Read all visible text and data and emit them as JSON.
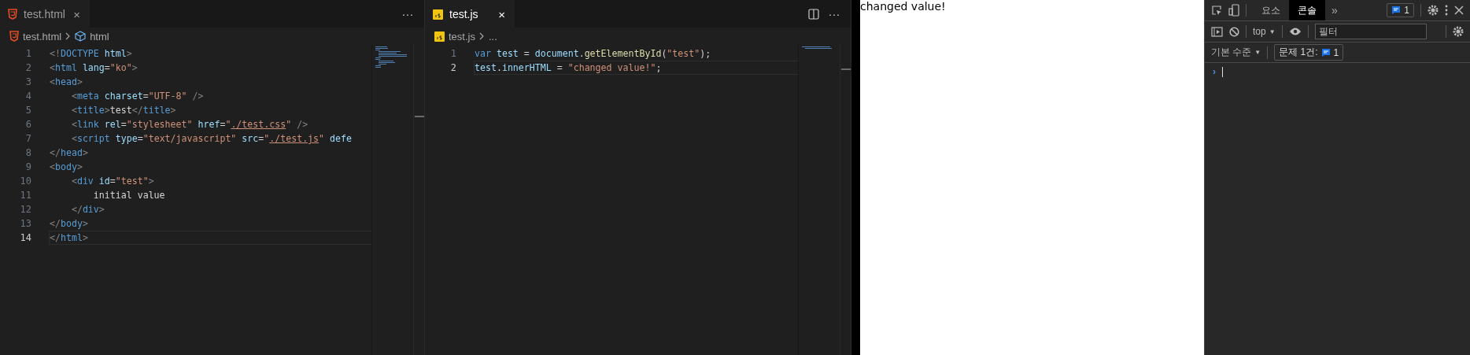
{
  "editors": [
    {
      "focused": false,
      "tabs": [
        {
          "label": "test.html",
          "close": "×",
          "selected": true
        }
      ],
      "more": "···",
      "breadcrumb": [
        {
          "label": "test.html"
        },
        {
          "label": "html"
        }
      ],
      "lines": [
        {
          "number": "1",
          "current": false,
          "tokens": [
            {
              "t": "<!",
              "kind": "punct"
            },
            {
              "t": "DOCTYPE",
              "kind": "tag"
            },
            {
              "t": " html",
              "kind": "attr"
            },
            {
              "t": ">",
              "kind": "punct"
            }
          ]
        },
        {
          "number": "2",
          "current": false,
          "tokens": [
            {
              "t": "<",
              "kind": "punct"
            },
            {
              "t": "html",
              "kind": "tag"
            },
            {
              "t": " lang",
              "kind": "attr"
            },
            {
              "t": "=",
              "kind": "text"
            },
            {
              "t": "\"ko\"",
              "kind": "str"
            },
            {
              "t": ">",
              "kind": "punct"
            }
          ]
        },
        {
          "number": "3",
          "current": false,
          "tokens": [
            {
              "t": "<",
              "kind": "punct"
            },
            {
              "t": "head",
              "kind": "tag"
            },
            {
              "t": ">",
              "kind": "punct"
            }
          ]
        },
        {
          "number": "4",
          "current": false,
          "tokens": [
            {
              "t": "    <",
              "kind": "punct"
            },
            {
              "t": "meta",
              "kind": "tag"
            },
            {
              "t": " charset",
              "kind": "attr"
            },
            {
              "t": "=",
              "kind": "text"
            },
            {
              "t": "\"UTF-8\"",
              "kind": "str"
            },
            {
              "t": " />",
              "kind": "punct"
            }
          ]
        },
        {
          "number": "5",
          "current": false,
          "tokens": [
            {
              "t": "    <",
              "kind": "punct"
            },
            {
              "t": "title",
              "kind": "tag"
            },
            {
              "t": ">",
              "kind": "punct"
            },
            {
              "t": "test",
              "kind": "text"
            },
            {
              "t": "</",
              "kind": "punct"
            },
            {
              "t": "title",
              "kind": "tag"
            },
            {
              "t": ">",
              "kind": "punct"
            }
          ]
        },
        {
          "number": "6",
          "current": false,
          "tokens": [
            {
              "t": "    <",
              "kind": "punct"
            },
            {
              "t": "link",
              "kind": "tag"
            },
            {
              "t": " rel",
              "kind": "attr"
            },
            {
              "t": "=",
              "kind": "text"
            },
            {
              "t": "\"stylesheet\"",
              "kind": "str"
            },
            {
              "t": " href",
              "kind": "attr"
            },
            {
              "t": "=",
              "kind": "text"
            },
            {
              "t": "\"",
              "kind": "str"
            },
            {
              "t": "./test.css",
              "kind": "link"
            },
            {
              "t": "\"",
              "kind": "str"
            },
            {
              "t": " />",
              "kind": "punct"
            }
          ]
        },
        {
          "number": "7",
          "current": false,
          "tokens": [
            {
              "t": "    <",
              "kind": "punct"
            },
            {
              "t": "script",
              "kind": "tag"
            },
            {
              "t": " type",
              "kind": "attr"
            },
            {
              "t": "=",
              "kind": "text"
            },
            {
              "t": "\"text/javascript\"",
              "kind": "str"
            },
            {
              "t": " src",
              "kind": "attr"
            },
            {
              "t": "=",
              "kind": "text"
            },
            {
              "t": "\"",
              "kind": "str"
            },
            {
              "t": "./test.js",
              "kind": "link"
            },
            {
              "t": "\"",
              "kind": "str"
            },
            {
              "t": " defe",
              "kind": "attr"
            }
          ]
        },
        {
          "number": "8",
          "current": false,
          "tokens": [
            {
              "t": "</",
              "kind": "punct"
            },
            {
              "t": "head",
              "kind": "tag"
            },
            {
              "t": ">",
              "kind": "punct"
            }
          ]
        },
        {
          "number": "9",
          "current": false,
          "tokens": [
            {
              "t": "<",
              "kind": "punct"
            },
            {
              "t": "body",
              "kind": "tag"
            },
            {
              "t": ">",
              "kind": "punct"
            }
          ]
        },
        {
          "number": "10",
          "current": false,
          "tokens": [
            {
              "t": "    <",
              "kind": "punct"
            },
            {
              "t": "div",
              "kind": "tag"
            },
            {
              "t": " id",
              "kind": "attr"
            },
            {
              "t": "=",
              "kind": "text"
            },
            {
              "t": "\"test\"",
              "kind": "str"
            },
            {
              "t": ">",
              "kind": "punct"
            }
          ]
        },
        {
          "number": "11",
          "current": false,
          "tokens": [
            {
              "t": "        initial value",
              "kind": "text"
            }
          ]
        },
        {
          "number": "12",
          "current": false,
          "tokens": [
            {
              "t": "    </",
              "kind": "punct"
            },
            {
              "t": "div",
              "kind": "tag"
            },
            {
              "t": ">",
              "kind": "punct"
            }
          ]
        },
        {
          "number": "13",
          "current": false,
          "tokens": [
            {
              "t": "</",
              "kind": "punct"
            },
            {
              "t": "body",
              "kind": "tag"
            },
            {
              "t": ">",
              "kind": "punct"
            }
          ]
        },
        {
          "number": "14",
          "current": true,
          "tokens": [
            {
              "t": "</",
              "kind": "punct"
            },
            {
              "t": "html",
              "kind": "tag"
            },
            {
              "t": ">",
              "kind": "punct"
            }
          ]
        }
      ]
    },
    {
      "focused": true,
      "tabs": [
        {
          "label": "test.js",
          "close": "×",
          "selected": true
        }
      ],
      "more": "···",
      "breadcrumb": [
        {
          "label": "test.js"
        },
        {
          "label": "..."
        }
      ],
      "lines": [
        {
          "number": "1",
          "current": false,
          "tokens": [
            {
              "t": "var",
              "kind": "keyword"
            },
            {
              "t": " test",
              "kind": "attr"
            },
            {
              "t": " = ",
              "kind": "text"
            },
            {
              "t": "document",
              "kind": "attr"
            },
            {
              "t": ".",
              "kind": "text"
            },
            {
              "t": "getElementById",
              "kind": "func"
            },
            {
              "t": "(",
              "kind": "text"
            },
            {
              "t": "\"test\"",
              "kind": "str"
            },
            {
              "t": ");",
              "kind": "text"
            }
          ]
        },
        {
          "number": "2",
          "current": true,
          "tokens": [
            {
              "t": "test",
              "kind": "attr"
            },
            {
              "t": ".",
              "kind": "text"
            },
            {
              "t": "innerHTML",
              "kind": "attr"
            },
            {
              "t": " = ",
              "kind": "text"
            },
            {
              "t": "\"changed value!\"",
              "kind": "str"
            },
            {
              "t": ";",
              "kind": "text"
            }
          ]
        }
      ]
    }
  ],
  "browser": {
    "content": "changed value!"
  },
  "devtools": {
    "tabs": [
      {
        "label": "요소",
        "selected": false
      },
      {
        "label": "콘솔",
        "selected": true
      }
    ],
    "more_tabs": "»",
    "issues_badge": "1",
    "context": {
      "label": "top",
      "caret": "▼"
    },
    "filter": {
      "placeholder": "필터"
    },
    "level": {
      "label": "기본 수준",
      "caret": "▼"
    },
    "issues_button": {
      "label": "문제 1건:",
      "count": "1"
    },
    "prompt": "›"
  }
}
